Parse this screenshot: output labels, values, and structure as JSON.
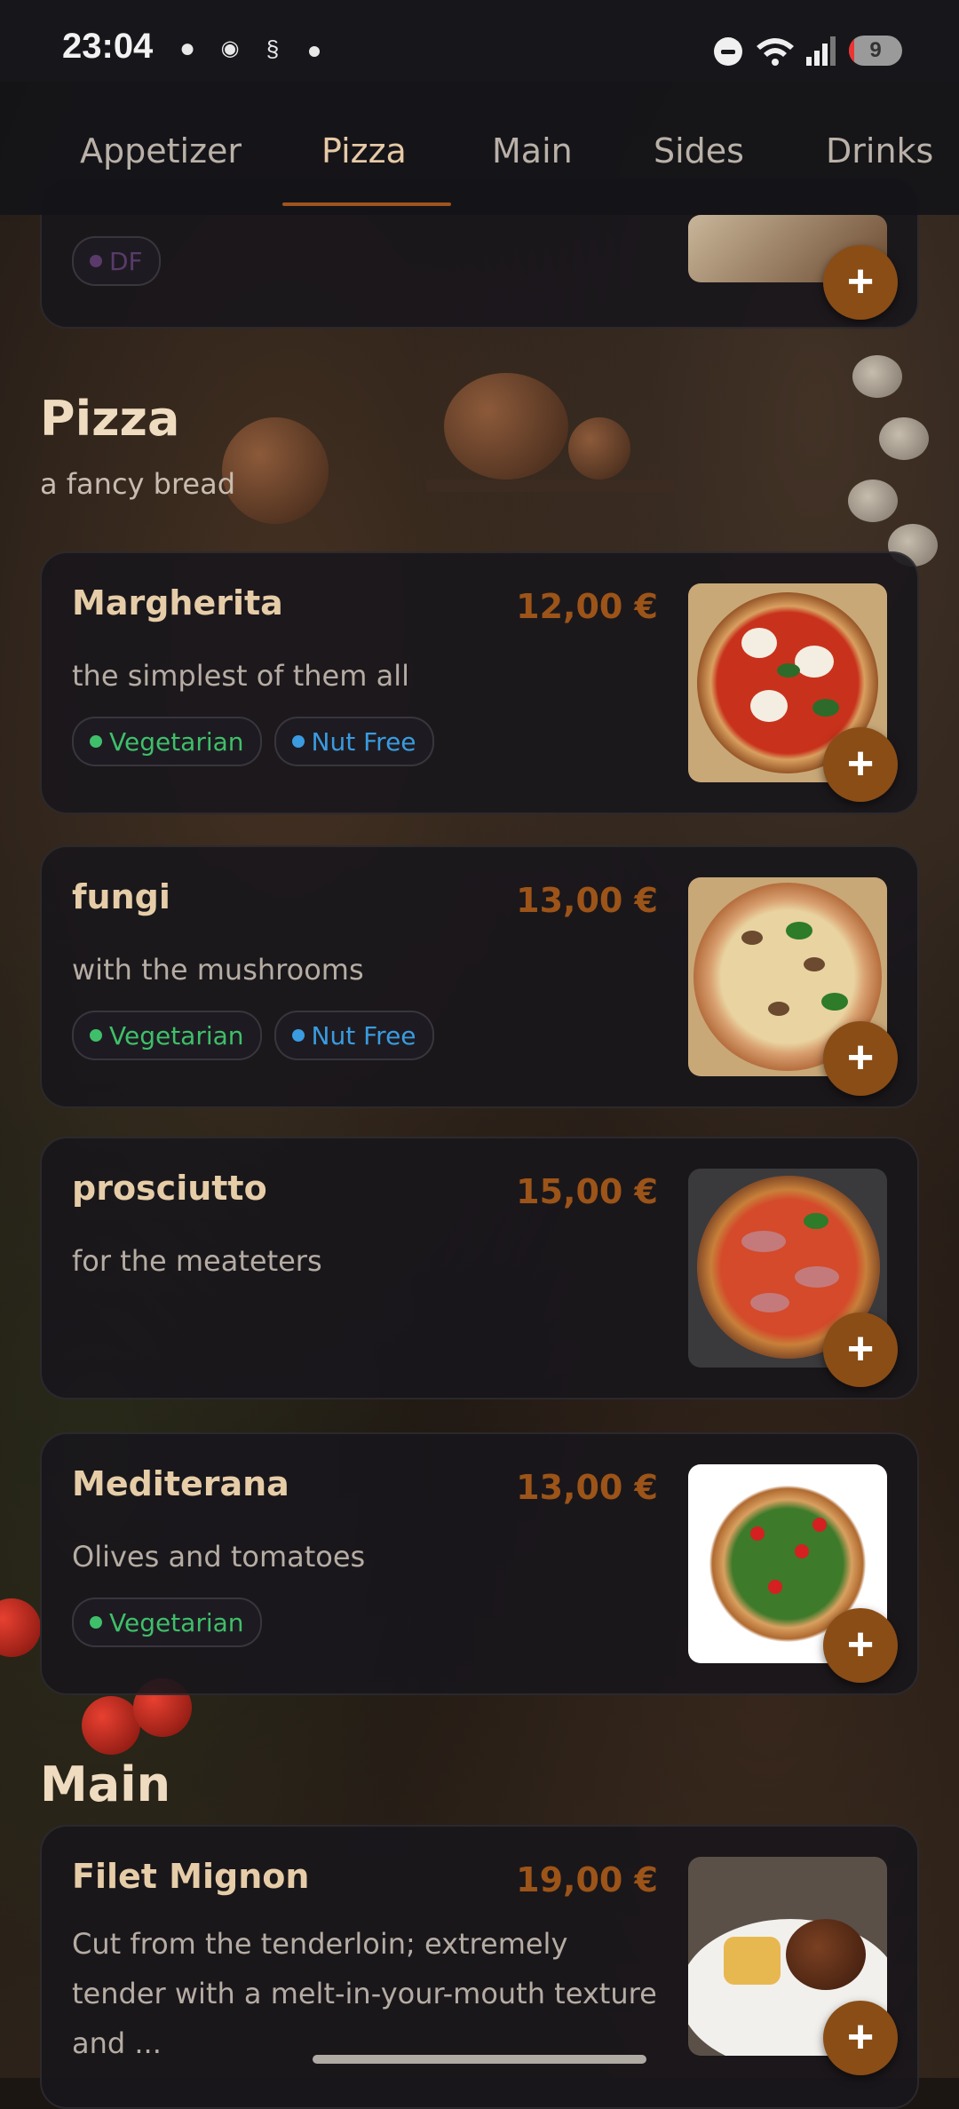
{
  "status_bar": {
    "time": "23:04",
    "battery_level": "9",
    "icons": [
      "snapchat-icon",
      "discord-icon",
      "app-icon",
      "dnd-icon",
      "wifi-icon",
      "signal-icon",
      "battery-icon"
    ]
  },
  "tabs": [
    {
      "label": "Appetizer",
      "active": false
    },
    {
      "label": "Pizza",
      "active": true
    },
    {
      "label": "Main",
      "active": false
    },
    {
      "label": "Sides",
      "active": false
    },
    {
      "label": "Drinks",
      "active": false
    }
  ],
  "prev_card": {
    "tag": "DF",
    "add_label": "+"
  },
  "pizza_section": {
    "title": "Pizza",
    "subtitle": "a fancy bread",
    "items": [
      {
        "name": "Margherita",
        "price": "12,00 €",
        "description": "the simplest of them all",
        "tags": [
          "Vegetarian",
          "Nut Free"
        ],
        "add_label": "+"
      },
      {
        "name": "fungi",
        "price": "13,00 €",
        "description": "with the mushrooms",
        "tags": [
          "Vegetarian",
          "Nut Free"
        ],
        "add_label": "+"
      },
      {
        "name": "prosciutto",
        "price": "15,00 €",
        "description": "for the meateters",
        "tags": [],
        "add_label": "+"
      },
      {
        "name": "Mediterana",
        "price": "13,00 €",
        "description": "Olives and tomatoes",
        "tags": [
          "Vegetarian"
        ],
        "add_label": "+"
      }
    ]
  },
  "main_section": {
    "title": "Main",
    "items": [
      {
        "name": "Filet Mignon",
        "price": "19,00 €",
        "description": "Cut from the tenderloin; extremely tender with a melt-in-your-mouth texture and ...",
        "add_label": "+"
      }
    ]
  },
  "colors": {
    "accent": "#8a4d16",
    "price": "#9c5418",
    "vegetarian": "#3fbf6a",
    "nut_free": "#3a9be0"
  }
}
